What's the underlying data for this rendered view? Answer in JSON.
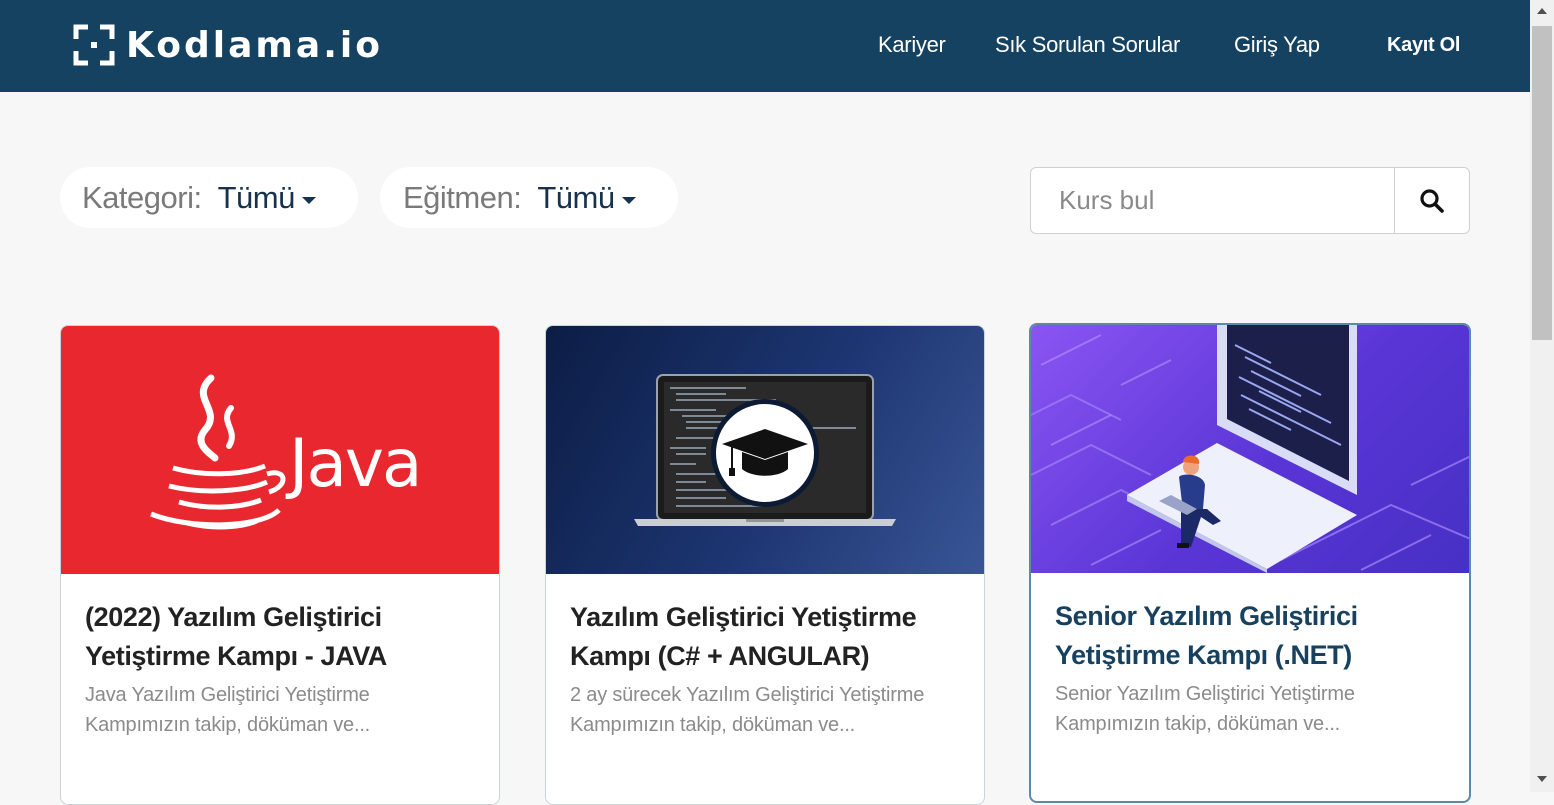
{
  "header": {
    "logo_text": "Kodlama.io",
    "nav": [
      {
        "label": "Kariyer"
      },
      {
        "label": "Sık Sorulan Sorular"
      },
      {
        "label": "Giriş Yap"
      },
      {
        "label": "Kayıt Ol"
      }
    ],
    "background": "#164261"
  },
  "filters": {
    "category": {
      "label": "Kategori:",
      "value": "Tümü"
    },
    "instructor": {
      "label": "Eğitmen:",
      "value": "Tümü"
    }
  },
  "search": {
    "placeholder": "Kurs bul",
    "value": "",
    "icon": "search-icon"
  },
  "courses": [
    {
      "title": "(2022) Yazılım Geliştirici Yetiştirme Kampı - JAVA",
      "description": "Java Yazılım Geliştirici Yetiştirme Kampımızın takip, döküman ve...",
      "image_text": "Java",
      "image": "java-logo",
      "accent": "#e8272f"
    },
    {
      "title": "Yazılım Geliştirici Yetiştirme Kampı (C# + ANGULAR)",
      "description": "2 ay sürecek Yazılım Geliştirici Yetiştirme Kampımızın takip, döküman ve...",
      "image": "laptop-graduation-cap",
      "accent": "#0f2550"
    },
    {
      "title": "Senior Yazılım Geliştirici Yetiştirme Kampı (.NET)",
      "description": "Senior Yazılım Geliştirici Yetiştirme Kampımızın takip, döküman ve...",
      "image": "isometric-laptop-developer",
      "accent": "#6a3fd8"
    }
  ]
}
